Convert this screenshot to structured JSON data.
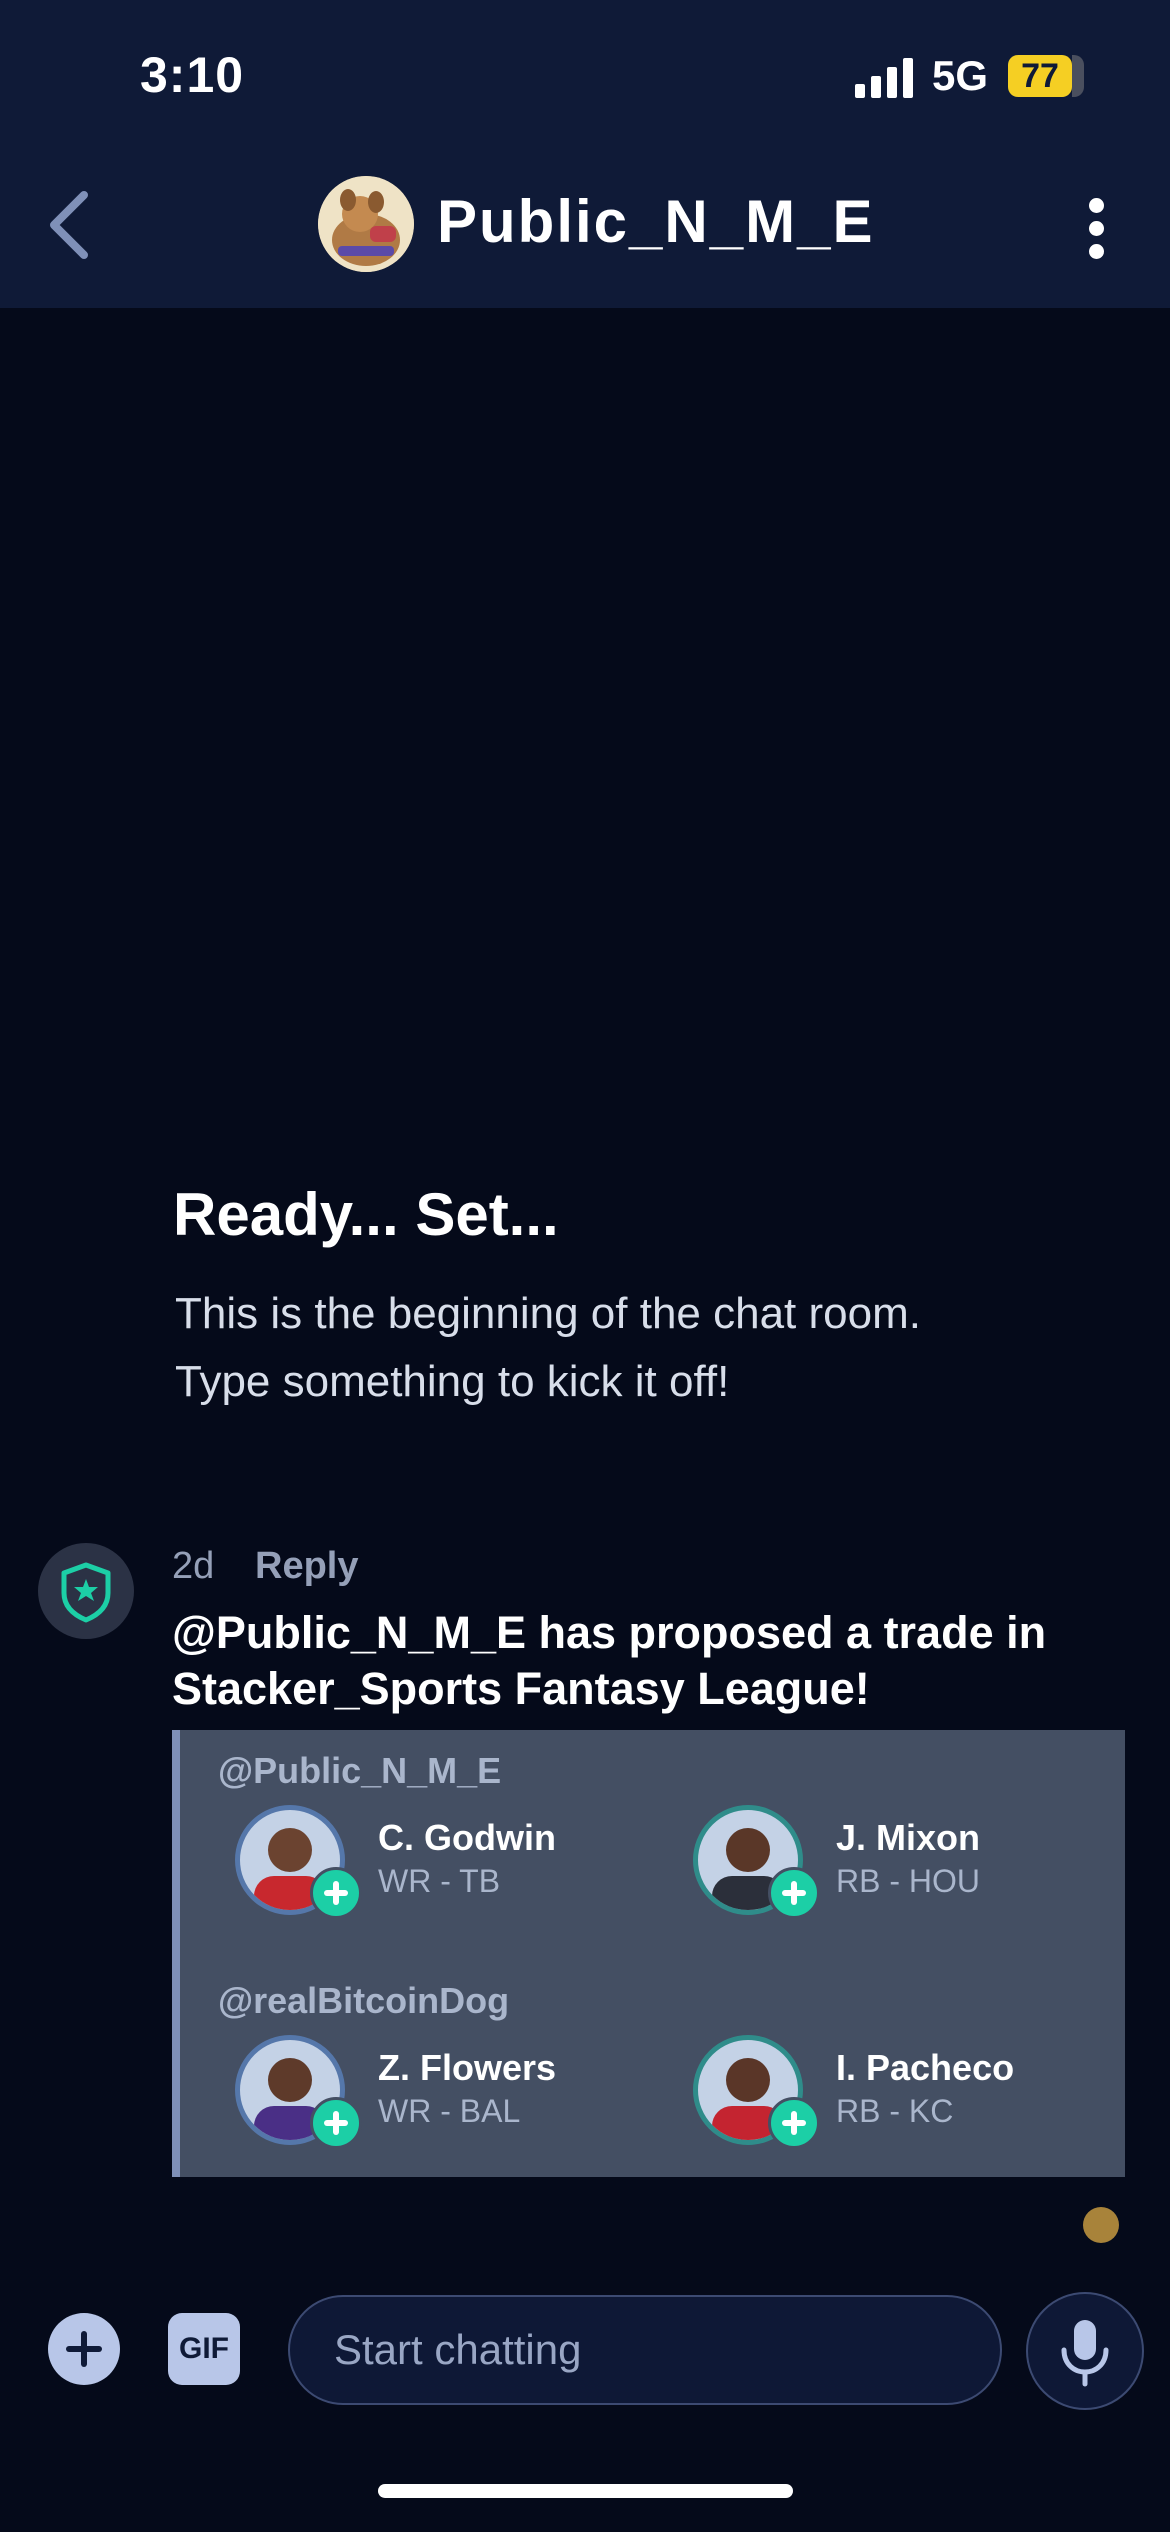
{
  "status_bar": {
    "time": "3:10",
    "network": "5G",
    "battery": "77"
  },
  "header": {
    "title": "Public_N_M_E"
  },
  "empty_state": {
    "title": "Ready... Set...",
    "line1": "This is the beginning of the chat room.",
    "line2": "Type something to kick it off!"
  },
  "message": {
    "time": "2d",
    "reply_label": "Reply",
    "text": "@Public_N_M_E has proposed a trade in Stacker_Sports Fantasy League!",
    "trade": {
      "side1": {
        "user": "@Public_N_M_E",
        "players": [
          {
            "name": "C. Godwin",
            "position": "WR - TB"
          },
          {
            "name": "J. Mixon",
            "position": "RB - HOU"
          }
        ]
      },
      "side2": {
        "user": "@realBitcoinDog",
        "players": [
          {
            "name": "Z. Flowers",
            "position": "WR - BAL"
          },
          {
            "name": "I. Pacheco",
            "position": "RB - KC"
          }
        ]
      }
    }
  },
  "composer": {
    "gif_label": "GIF",
    "placeholder": "Start chatting"
  },
  "colors": {
    "background": "#050a1a",
    "header": "#0f1a37",
    "accent": "#1ccfa6",
    "card": "#444f63"
  }
}
